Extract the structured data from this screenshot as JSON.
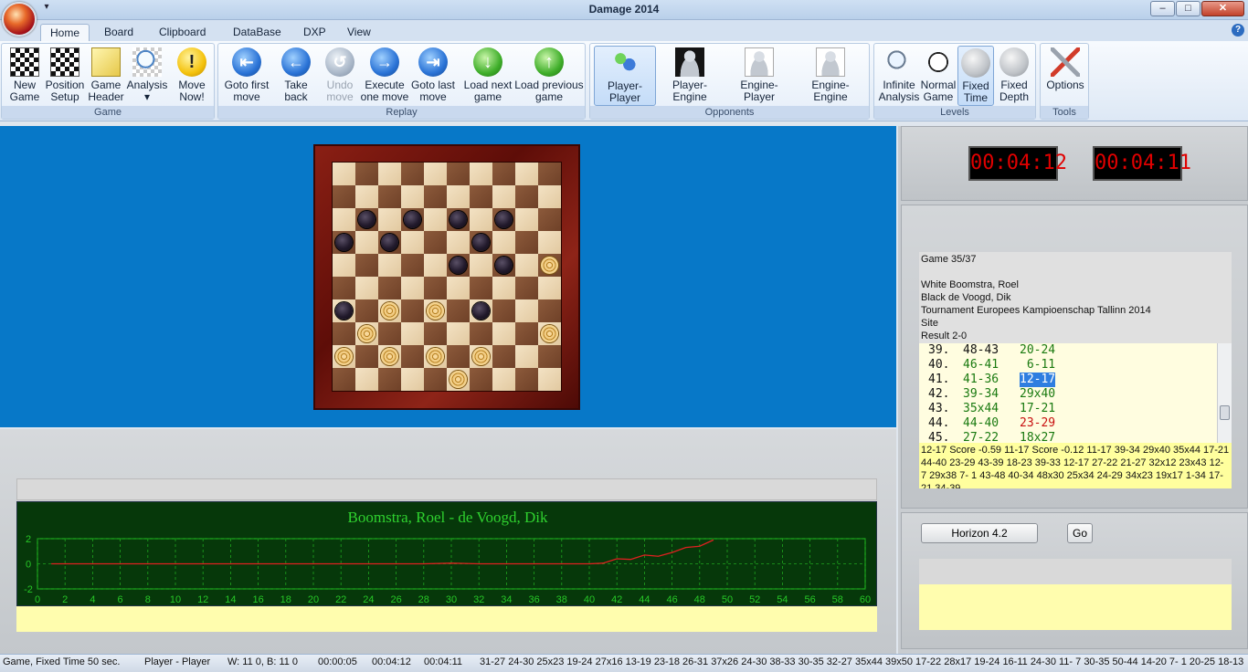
{
  "window": {
    "title": "Damage 2014",
    "minimize": "–",
    "maximize": "□",
    "close": "✕",
    "qat": "▾"
  },
  "tabs": [
    "Home",
    "Board",
    "Clipboard",
    "DataBase",
    "DXP",
    "View"
  ],
  "help": "?",
  "ribbon": {
    "game": {
      "label": "Game",
      "new_game": "New\nGame ▾",
      "position_setup": "Position\nSetup",
      "game_header": "Game\nHeader",
      "analysis": "Analysis\n▾",
      "move_now": "Move\nNow!"
    },
    "replay": {
      "label": "Replay",
      "first": "Goto first\nmove",
      "back": "Take back\nmove",
      "undo": "Undo\nmove",
      "execute": "Execute\none move",
      "last": "Goto last\nmove",
      "load_next": "Load next\ngame",
      "load_prev": "Load previous\ngame"
    },
    "opponents": {
      "label": "Opponents",
      "pp": "Player-Player",
      "pe": "Player-Engine",
      "ep": "Engine-Player",
      "ee": "Engine-Engine"
    },
    "levels": {
      "label": "Levels",
      "infinite": "Infinite\nAnalysis",
      "normal": "Normal\nGame",
      "fixed_time": "Fixed\nTime",
      "fixed_depth": "Fixed\nDepth"
    },
    "tools": {
      "label": "Tools",
      "options": "Options"
    }
  },
  "board": {
    "pieces": {
      "black": [
        [
          2,
          1
        ],
        [
          2,
          3
        ],
        [
          2,
          5
        ],
        [
          2,
          7
        ],
        [
          3,
          0
        ],
        [
          3,
          2
        ],
        [
          3,
          6
        ],
        [
          4,
          5
        ],
        [
          4,
          7
        ],
        [
          6,
          0
        ],
        [
          6,
          6
        ]
      ],
      "white": [
        [
          4,
          9
        ],
        [
          6,
          2
        ],
        [
          6,
          4
        ],
        [
          7,
          1
        ],
        [
          7,
          9
        ],
        [
          8,
          0
        ],
        [
          8,
          2
        ],
        [
          8,
          4
        ],
        [
          8,
          6
        ],
        [
          9,
          5
        ]
      ]
    }
  },
  "clocks": {
    "white": "00:04:12",
    "black": "00:04:11"
  },
  "game_info": {
    "game": "Game 35/37",
    "white": "White Boomstra, Roel",
    "black": "Black de Voogd, Dik",
    "tournament": "Tournament Europees Kampioenschap Tallinn  2014",
    "site": "Site",
    "result": "Result 2-0"
  },
  "moves": [
    {
      "num": "39.",
      "w": "48-43",
      "b": "20-24",
      "wc": "blk",
      "bc": ""
    },
    {
      "num": "40.",
      "w": "46-41",
      "b": " 6-11",
      "wc": "",
      "bc": ""
    },
    {
      "num": "41.",
      "w": "41-36",
      "b": "12-17",
      "wc": "",
      "bc": "hl"
    },
    {
      "num": "42.",
      "w": "39-34",
      "b": "29x40",
      "wc": "",
      "bc": ""
    },
    {
      "num": "43.",
      "w": "35x44",
      "b": "17-21",
      "wc": "",
      "bc": ""
    },
    {
      "num": "44.",
      "w": "44-40",
      "b": "23-29",
      "wc": "",
      "bc": "red"
    },
    {
      "num": "45.",
      "w": "27-22",
      "b": "18x27",
      "wc": "",
      "bc": ""
    }
  ],
  "analysis": "12-17 Score -0.59 11-17 Score -0.12  11-17 39-34 29x40 35x44 17-21 44-40 23-29 43-39 18-23 39-33 12-17 27-22 21-27 32x12 23x43 12- 7 29x38  7- 1 43-48 40-34 48x30 25x34 24-29 34x23 19x17  1-34 17-21 34-39",
  "engine": {
    "name": "Horizon 4.2",
    "go": "Go"
  },
  "chart_data": {
    "type": "line",
    "title": "Boomstra, Roel - de Voogd, Dik",
    "x_ticks": [
      0,
      2,
      4,
      6,
      8,
      10,
      12,
      14,
      16,
      18,
      20,
      22,
      24,
      26,
      28,
      30,
      32,
      34,
      36,
      38,
      40,
      42,
      44,
      46,
      48,
      50,
      52,
      54,
      56,
      58,
      60
    ],
    "y_ticks": [
      2,
      0,
      -2
    ],
    "xlim": [
      0,
      60
    ],
    "ylim": [
      -2,
      2
    ],
    "grid": true,
    "series": [
      {
        "color": "#e02020",
        "x": [
          1,
          4,
          8,
          12,
          16,
          20,
          24,
          28,
          30,
          32,
          36,
          40,
          41,
          42,
          43,
          44,
          45,
          46,
          47,
          48,
          49
        ],
        "y": [
          0,
          0,
          0,
          0,
          0,
          0,
          0,
          0,
          0.05,
          0,
          0,
          0,
          0.05,
          0.4,
          0.35,
          0.7,
          0.6,
          0.9,
          1.3,
          1.4,
          1.9
        ]
      }
    ]
  },
  "status": {
    "mode": "Game, Fixed Time 50 sec.",
    "opponents": "Player - Player",
    "count": "W: 11  0, B: 11  0",
    "t1": "00:00:05",
    "t2": "00:04:12",
    "t3": "00:04:11",
    "moves": "31-27 24-30 25x23 19-24 27x16 13-19 23-18 26-31 37x26 24-30 38-33 30-35 32-27 35x44 39x50 17-22 28x17 19-24 16-11 24-30 11- 7 30-35 50-44 14-20  7- 1 20-25 18-13"
  }
}
